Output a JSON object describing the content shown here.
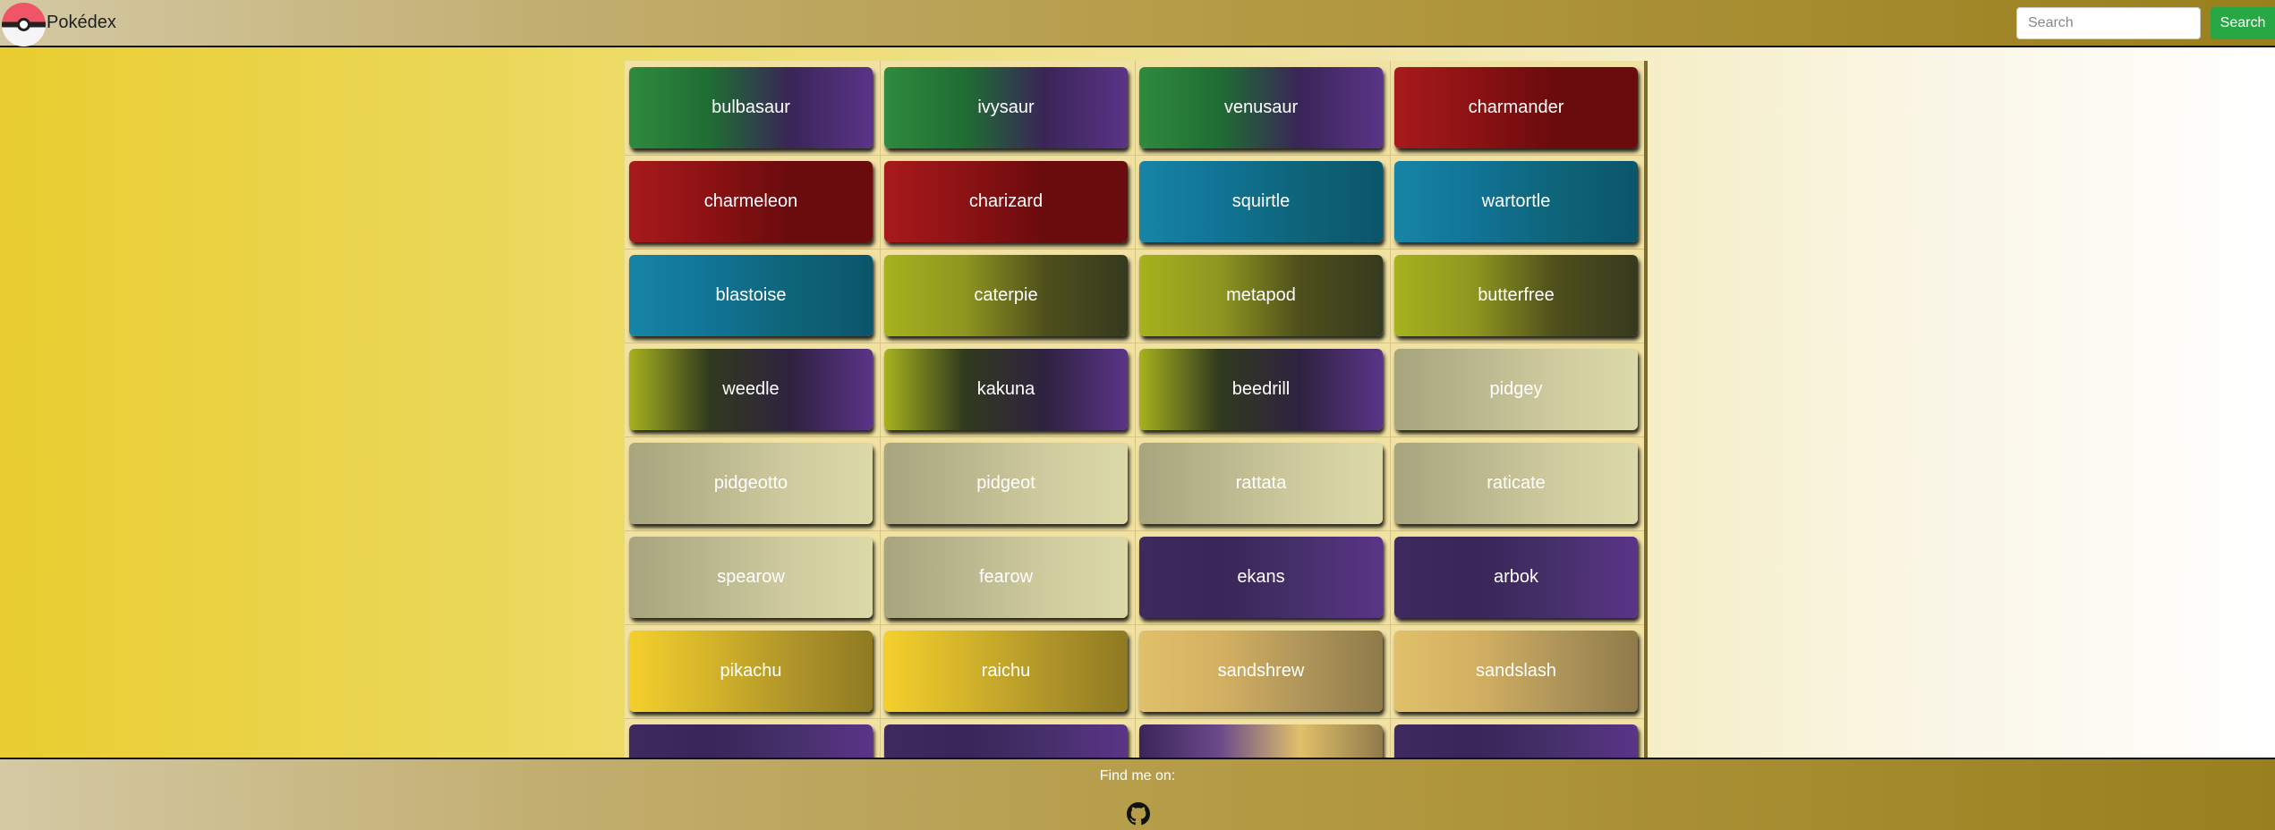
{
  "navbar": {
    "brand": "Pokédex",
    "logo_icon": "pokeball-icon",
    "search_placeholder": "Search",
    "search_button": "Search",
    "search_button_color": "#28a745"
  },
  "pokemon": [
    {
      "name": "bulbasaur",
      "type": "grass-poison"
    },
    {
      "name": "ivysaur",
      "type": "grass-poison"
    },
    {
      "name": "venusaur",
      "type": "grass-poison"
    },
    {
      "name": "charmander",
      "type": "fire"
    },
    {
      "name": "charmeleon",
      "type": "fire"
    },
    {
      "name": "charizard",
      "type": "fire"
    },
    {
      "name": "squirtle",
      "type": "water"
    },
    {
      "name": "wartortle",
      "type": "water"
    },
    {
      "name": "blastoise",
      "type": "water"
    },
    {
      "name": "caterpie",
      "type": "bug"
    },
    {
      "name": "metapod",
      "type": "bug"
    },
    {
      "name": "butterfree",
      "type": "bug"
    },
    {
      "name": "weedle",
      "type": "bug-poison"
    },
    {
      "name": "kakuna",
      "type": "bug-poison"
    },
    {
      "name": "beedrill",
      "type": "bug-poison"
    },
    {
      "name": "pidgey",
      "type": "normal"
    },
    {
      "name": "pidgeotto",
      "type": "normal"
    },
    {
      "name": "pidgeot",
      "type": "normal"
    },
    {
      "name": "rattata",
      "type": "normal"
    },
    {
      "name": "raticate",
      "type": "normal"
    },
    {
      "name": "spearow",
      "type": "normal"
    },
    {
      "name": "fearow",
      "type": "normal"
    },
    {
      "name": "ekans",
      "type": "poison"
    },
    {
      "name": "arbok",
      "type": "poison"
    },
    {
      "name": "pikachu",
      "type": "electric"
    },
    {
      "name": "raichu",
      "type": "electric"
    },
    {
      "name": "sandshrew",
      "type": "ground"
    },
    {
      "name": "sandslash",
      "type": "ground"
    },
    {
      "name": "",
      "type": "poison"
    },
    {
      "name": "",
      "type": "poison"
    },
    {
      "name": "",
      "type": "poison-ground"
    },
    {
      "name": "",
      "type": "poison"
    }
  ],
  "type_colors": {
    "grass-poison": [
      "#2f8a3e",
      "#1f6d33",
      "#3a2558",
      "#5a3488"
    ],
    "fire": [
      "#a71a1c",
      "#8c1214",
      "#6a0b0d",
      "#6a0b0d"
    ],
    "water": [
      "#1784a6",
      "#117496",
      "#0e6478",
      "#0c556b"
    ],
    "bug": [
      "#a6b21e",
      "#8e9620",
      "#4e4f1c",
      "#363a1e"
    ],
    "bug-poison": [
      "#a6b21e",
      "#303a1e",
      "#2f2240",
      "#5a3488"
    ],
    "normal": [
      "#a7a57d",
      "#bab78f",
      "#cfcb9e",
      "#dcd9a9"
    ],
    "poison": [
      "#3f2a5e",
      "#3a2558",
      "#46306a",
      "#5a3488"
    ],
    "electric": [
      "#f4d02d",
      "#d4b42a",
      "#b0952a",
      "#8f7a22"
    ],
    "ground": [
      "#e0c06a",
      "#d4b062",
      "#b0965a",
      "#8f7a4a"
    ],
    "poison-ground": [
      "#3a2558",
      "#6a4a8a",
      "#e0c06a",
      "#8f7a4a"
    ]
  },
  "footer": {
    "text": "Find me on:",
    "icon": "github-icon"
  }
}
